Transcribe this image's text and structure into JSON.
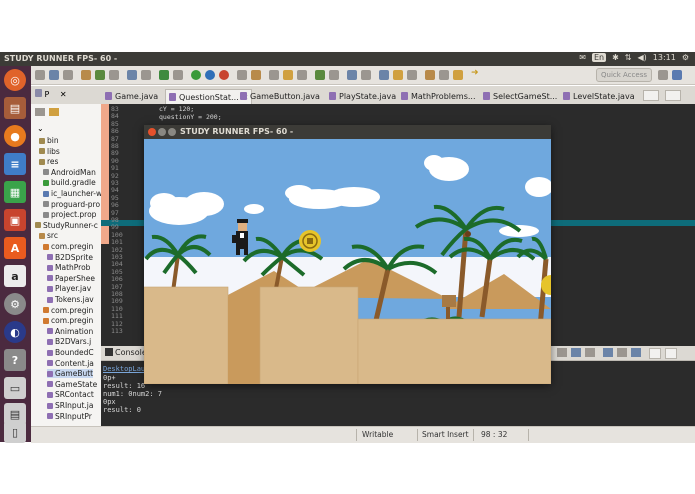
{
  "system": {
    "window_title": "STUDY RUNNER  FPS- 60 -",
    "keyboard_badge": "En",
    "time": "13:11"
  },
  "toolbar": {
    "quick_access_label": "Quick Access"
  },
  "tabs": [
    {
      "label": "Game.java",
      "active": false
    },
    {
      "label": "QuestionStat...",
      "active": true
    },
    {
      "label": "GameButton.java",
      "active": false
    },
    {
      "label": "PlayState.java",
      "active": false
    },
    {
      "label": "MathProblems...",
      "active": false
    },
    {
      "label": "SelectGameSt...",
      "active": false
    },
    {
      "label": "LevelState.java",
      "active": false
    }
  ],
  "explorer": {
    "header_label": "P",
    "items": [
      "bin",
      "libs",
      "res",
      "AndroidMan",
      "build.gradle",
      "ic_launcher-w",
      "proguard-pro",
      "project.prop",
      "StudyRunner-c",
      "src",
      "com.pregin",
      "B2DSprite",
      "MathProb",
      "PaperShee",
      "Player.jav",
      "Tokens.jav",
      "com.pregin",
      "com.pregin",
      "Animation",
      "B2DVars.j",
      "BoundedC",
      "Content.ja",
      "GameButt",
      "GameState",
      "SRContact",
      "SRInput.ja",
      "SRInputPr"
    ]
  },
  "editor": {
    "line_numbers": [
      "83",
      "84",
      "85",
      "86",
      "87",
      "88",
      "89",
      "90",
      "91",
      "92",
      "93",
      "94",
      "95",
      "96",
      "97",
      "98",
      "99",
      "100",
      "101",
      "102",
      "103",
      "104",
      "105",
      "106",
      "107",
      "108",
      "109",
      "110",
      "111",
      "112",
      "113"
    ],
    "code_lines": [
      "cY = 120;",
      "questionY = 200;"
    ]
  },
  "console": {
    "tab_label": "Console",
    "source_label": "DesktopLau",
    "lines": [
      "0p+",
      "result: 16",
      "num1: 0num2: 7",
      "0px",
      "result: 0"
    ]
  },
  "status": {
    "mode": "Writable",
    "insert": "Smart Insert",
    "position": "98 : 32"
  },
  "game": {
    "window_title": "STUDY RUNNER  FPS- 60 -",
    "colors": {
      "sky": "#6fa8de",
      "cloud": "#ffffff",
      "sand": "#d9b98a",
      "hill": "#c99a5c",
      "palm_leaf": "#1c6b2a",
      "coin": "#e6c42a"
    }
  }
}
